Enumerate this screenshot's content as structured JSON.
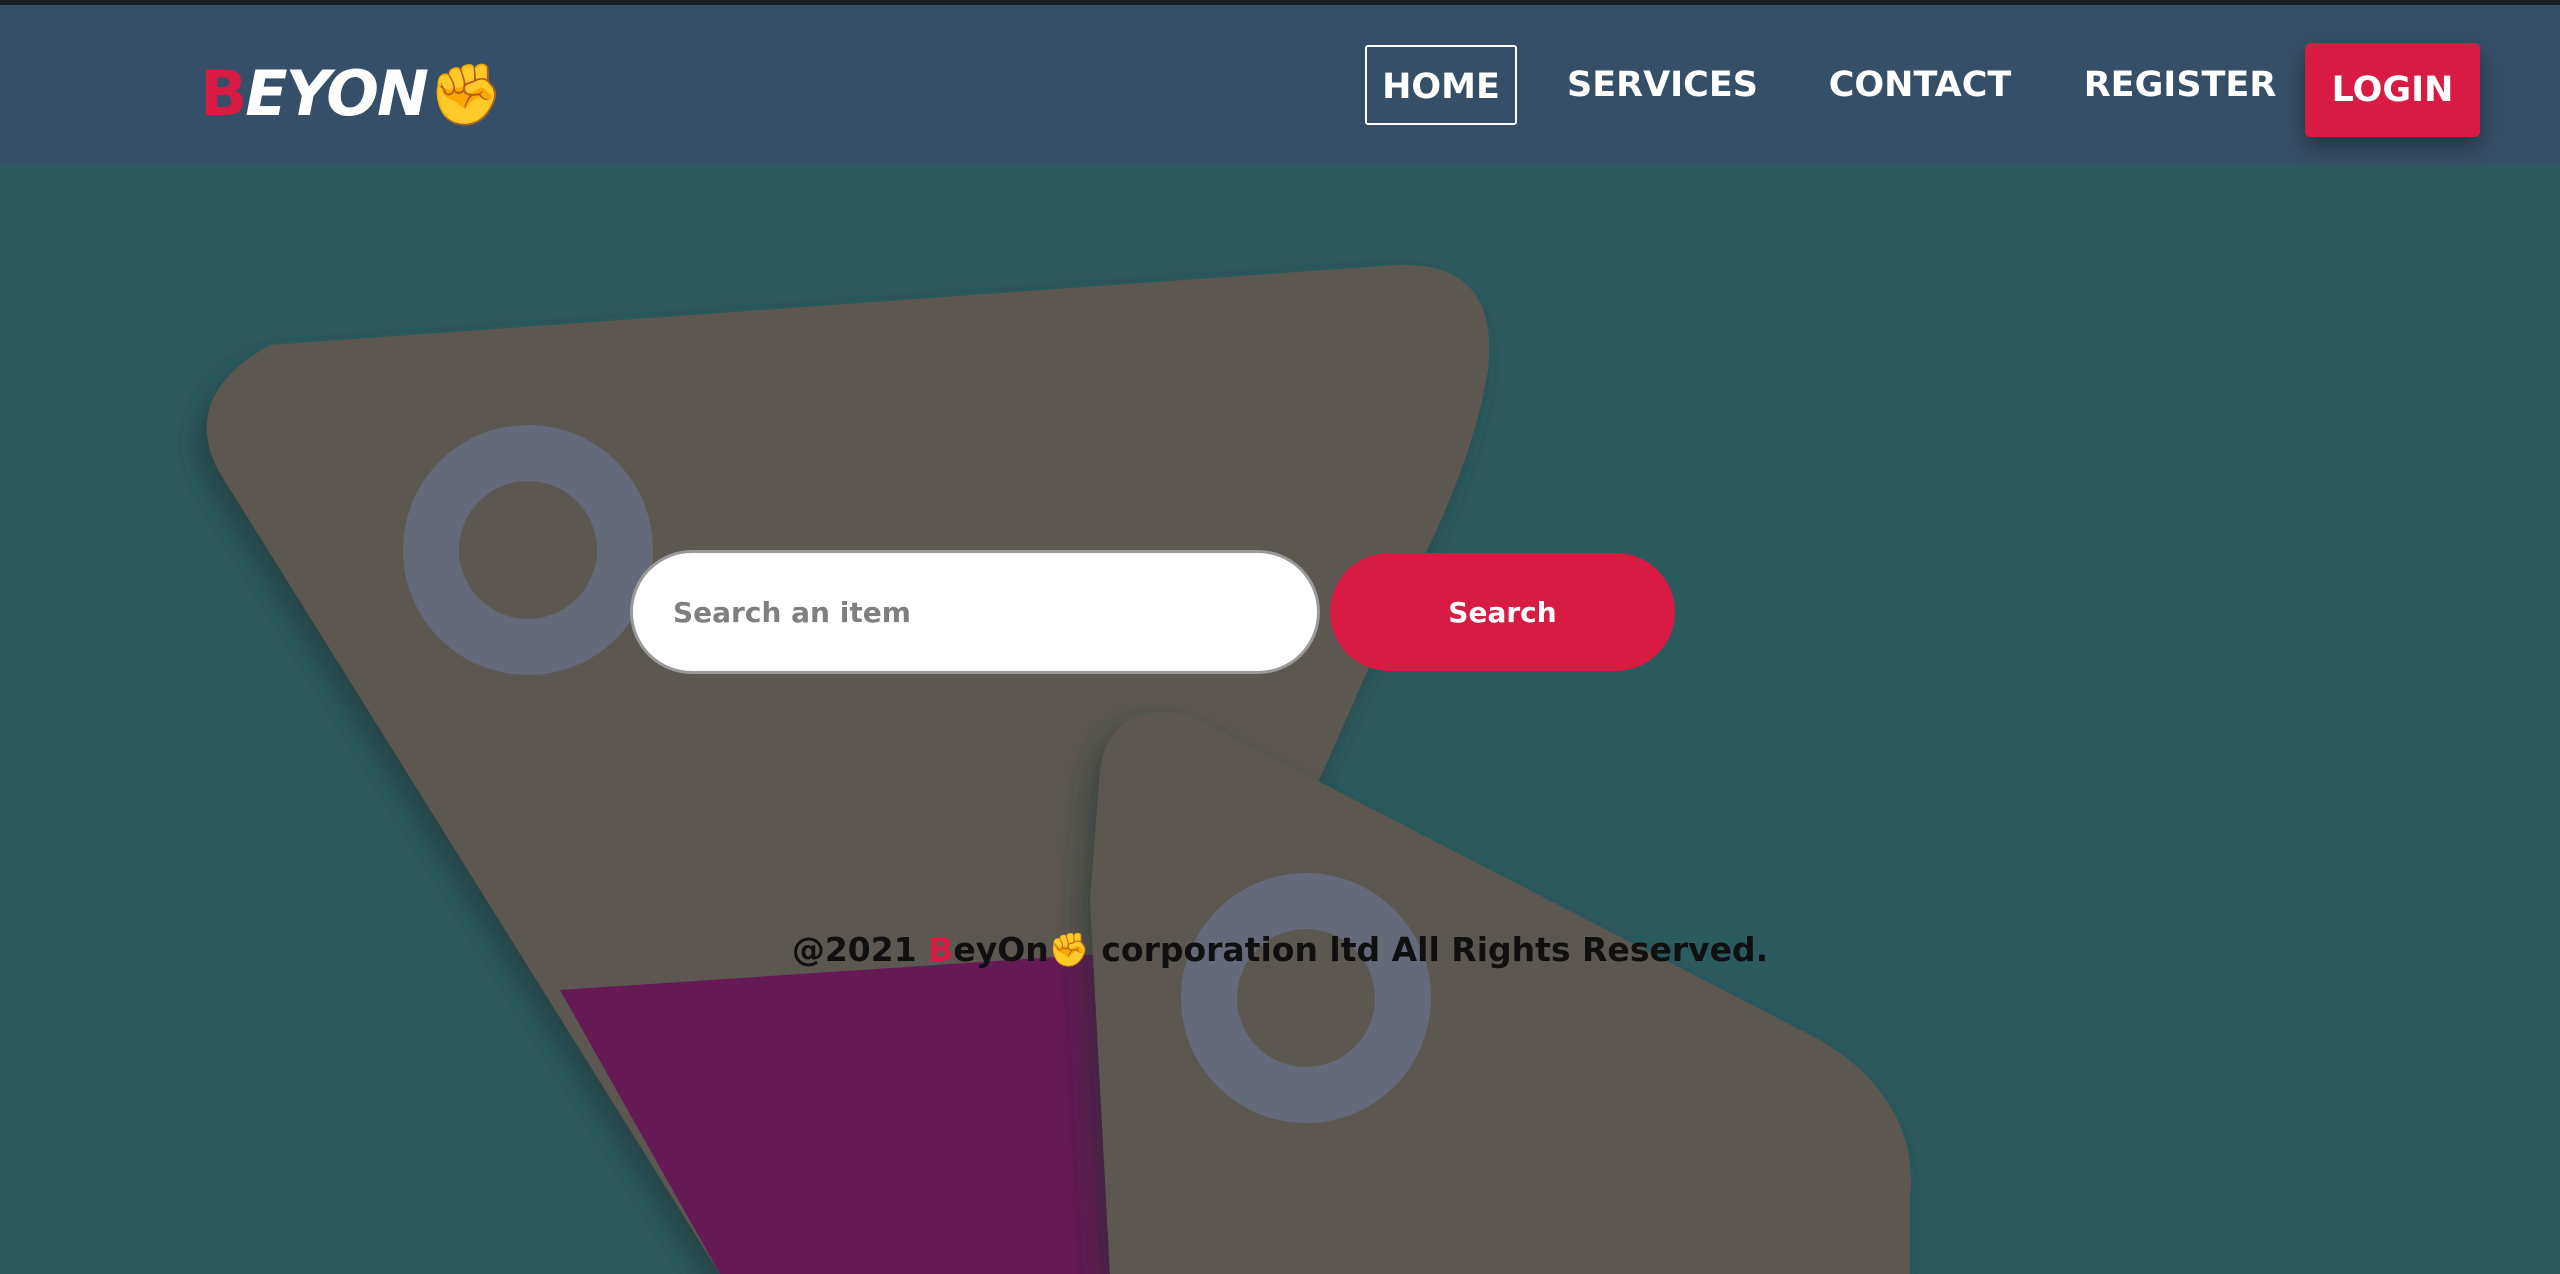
{
  "logo": {
    "first_letter": "B",
    "rest": "EYON",
    "emoji": "✊"
  },
  "nav": {
    "items": [
      {
        "label": "HOME",
        "active": true
      },
      {
        "label": "SERVICES"
      },
      {
        "label": "CONTACT"
      },
      {
        "label": "REGISTER"
      },
      {
        "label": "LOGIN"
      }
    ]
  },
  "search": {
    "placeholder": "Search an item",
    "value": "",
    "button_label": "Search"
  },
  "footer": {
    "prefix": "@2021 ",
    "brand_first": "B",
    "brand_rest": "eyOn",
    "emoji": "✊",
    "suffix": " corporation ltd All Rights Reserved."
  },
  "colors": {
    "accent": "#d81b43",
    "navbar": "#364f68",
    "background": "#2c5b5f"
  }
}
